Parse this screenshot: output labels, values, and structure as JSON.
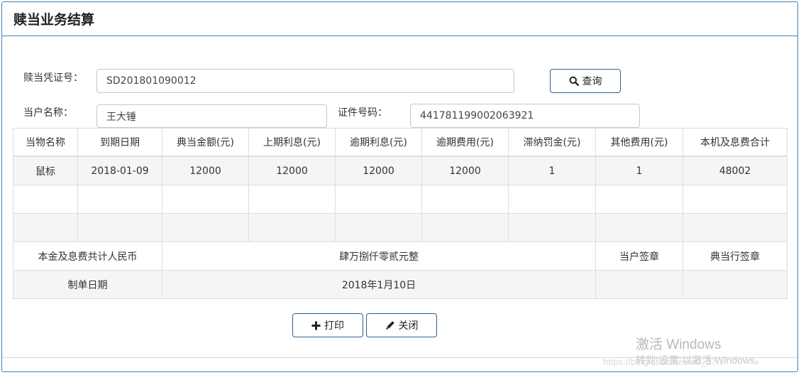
{
  "panel": {
    "title": "赎当业务结算"
  },
  "form": {
    "redeem_no_label": "赎当凭证号：",
    "redeem_no_value": "SD201801090012",
    "search_label": "查询",
    "customer_label": "当户名称：",
    "customer_value": "王大锤",
    "id_label": "证件号码：",
    "id_value": "441781199002063921"
  },
  "table": {
    "headers": [
      "当物名称",
      "到期日期",
      "典当金额(元)",
      "上期利息(元)",
      "逾期利息(元)",
      "逾期费用(元)",
      "滞纳罚金(元)",
      "其他费用(元)",
      "本机及息费合计"
    ],
    "row": [
      "鼠标",
      "2018-01-09",
      "12000",
      "12000",
      "12000",
      "12000",
      "1",
      "1",
      "48002"
    ],
    "total_label": "本金及息费共计人民币",
    "total_value": "肆万捌仟零贰元整",
    "customer_sign_label": "当户签章",
    "shop_sign_label": "典当行签章",
    "date_label": "制单日期",
    "date_value": "2018年1月10日"
  },
  "actions": {
    "print_label": "打印",
    "close_label": "关闭"
  },
  "watermark": {
    "line1": "激活 Windows",
    "line2": "转到“设置”以激活 Windows。",
    "url": "https://blog.csdn.net/m0_37..."
  },
  "colors": {
    "border": "#4a7fb5",
    "button_border": "#2e5f8f",
    "row_alt": "#f5f5f5"
  }
}
